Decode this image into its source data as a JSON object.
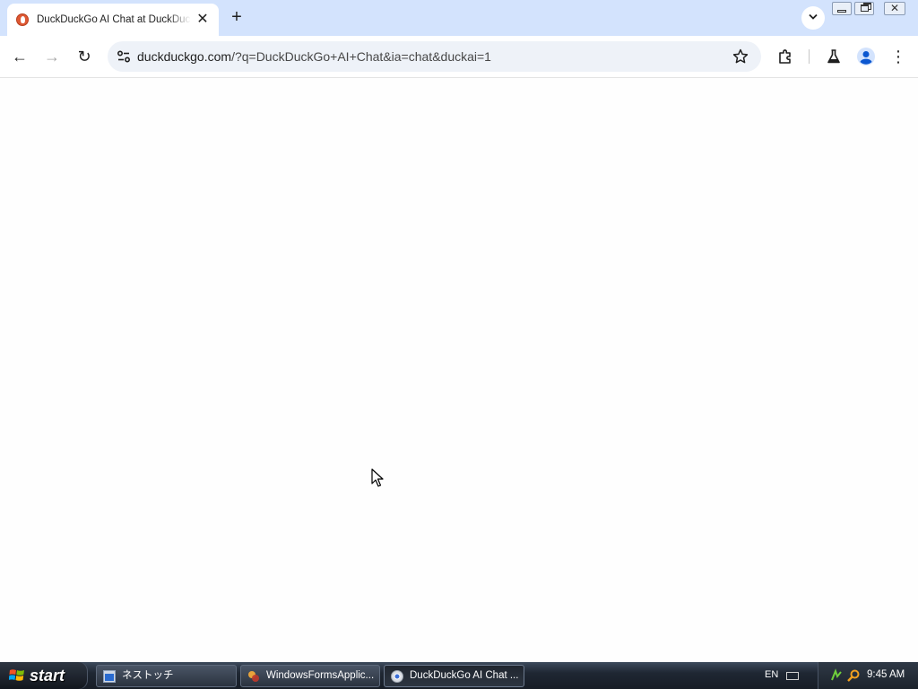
{
  "browser": {
    "tab": {
      "title": "DuckDuckGo AI Chat at DuckDuckGo",
      "close_glyph": "✕",
      "favicon": "duckduckgo-icon"
    },
    "new_tab_glyph": "+",
    "address": {
      "host": "duckduckgo.com",
      "path": "/?q=DuckDuckGo+AI+Chat&ia=chat&duckai=1"
    },
    "toolbar": {
      "back_glyph": "←",
      "forward_glyph": "→",
      "reload_glyph": "↻",
      "menu_glyph": "⋮"
    },
    "window_controls": {
      "close_glyph": "✕"
    }
  },
  "taskbar": {
    "start_label": "start",
    "tasks": [
      {
        "label": "ネストッチ"
      },
      {
        "label": "WindowsFormsApplic..."
      },
      {
        "label": "DuckDuckGo AI Chat ..."
      }
    ],
    "language": "EN",
    "clock": "9:45 AM"
  },
  "colors": {
    "tabstrip": "#d3e3fd",
    "omnibox": "#eef2f8",
    "taskbar": "#1f2733",
    "duckduckgo_brand": "#de5833"
  }
}
